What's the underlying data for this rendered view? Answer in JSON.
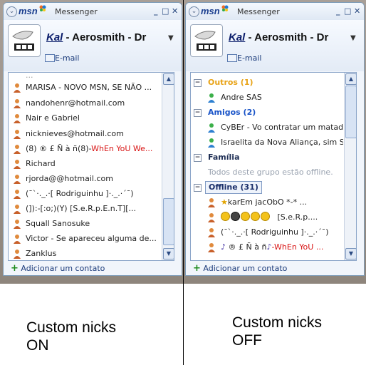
{
  "window_title": "Messenger",
  "brand": "msn",
  "display_nick": "Kal",
  "display_rest": " - Aerosmith - Dr",
  "email_label": "E-mail",
  "add_contact": "Adicionar um contato",
  "left": {
    "rows": [
      {
        "text": "MARISA - NOVO MSN, SE NÃO ..."
      },
      {
        "text": "nandohenr@hotmail.com"
      },
      {
        "text": "Nair  e Gabriel"
      },
      {
        "text": "nicknieves@hotmail.com"
      },
      {
        "text": "(8) ® £ Ñ à ñ(8)-",
        "red": "WhEn YoU We..."
      },
      {
        "text": "Richard"
      },
      {
        "text": "rjorda@@hotmail.com"
      },
      {
        "text": "(¯`·._.·[ Rodriguinhu ]·._.·´¯)"
      },
      {
        "text": "(]):-[:o;)(Y)  [S.e.R.p.E.n.T][..."
      },
      {
        "text": "Squall Sanosuke"
      },
      {
        "text": "Victor - Se apareceu alguma de..."
      },
      {
        "text": "Zanklus"
      }
    ]
  },
  "right": {
    "groups": {
      "outros": "Outros (1)",
      "amigos": "Amigos (2)",
      "familia": "Família",
      "offline": "Offline (31)"
    },
    "outros_contacts": [
      "Andre SAS"
    ],
    "amigos_contacts": [
      "CyBEr - Vo contratar um matad...",
      "Israelita da Nova Aliança, sim S..."
    ],
    "familia_note": "Todos deste grupo estão offline.",
    "offline_rows": [
      {
        "text": "karEm jacObO     *-*         ..."
      },
      {
        "text": "[S.e.R.p...."
      },
      {
        "text": "(¯`·._.·[ Rodriguinhu ]·._.·´¯)"
      },
      {
        "text": "® £ Ñ à ñ",
        "red": "-WhEn YoU ..."
      }
    ]
  },
  "captions": {
    "left_line1": "Custom nicks",
    "left_line2": "ON",
    "right_line1": "Custom nicks",
    "right_line2": "OFF"
  },
  "colors": {
    "outros_group": "#e8a317",
    "amigos_group": "#1a54c8",
    "familia_group": "#1f2f55",
    "offline_group": "#1a2f6a",
    "red_text": "#d81414"
  }
}
